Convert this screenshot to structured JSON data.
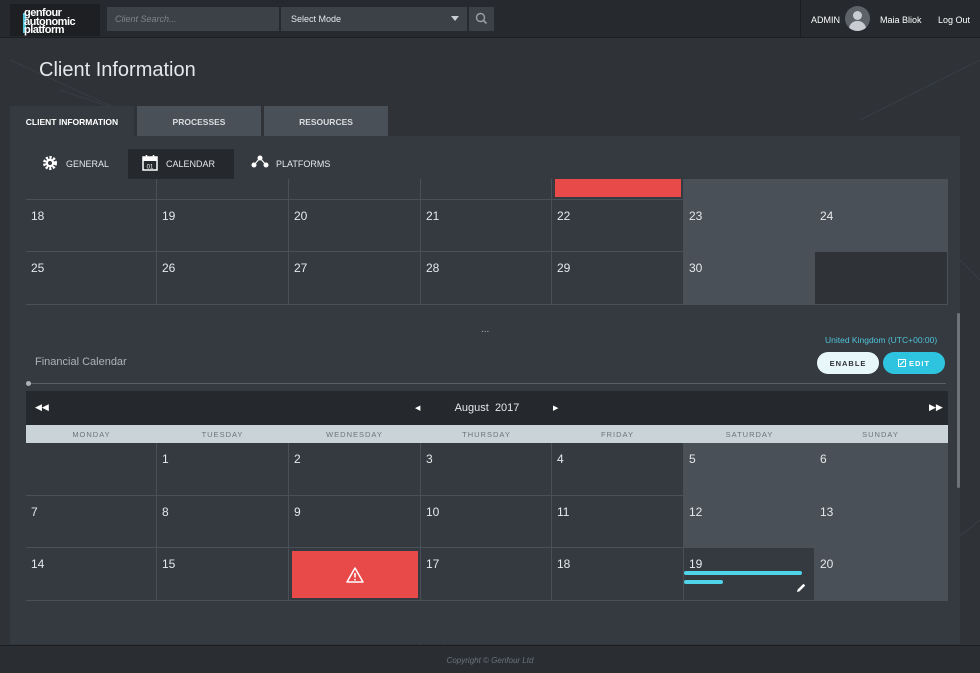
{
  "header": {
    "logo_lines": [
      "genfour",
      "autonomic",
      "platform"
    ],
    "search_placeholder": "Client Search...",
    "mode_select": "Select Mode",
    "role": "ADMIN",
    "user_name": "Maia Bliok",
    "logout": "Log Out"
  },
  "page_title": "Client Information",
  "main_tabs": [
    "CLIENT INFORMATION",
    "PROCESSES",
    "RESOURCES"
  ],
  "sub_tabs": [
    "GENERAL",
    "CALENDAR",
    "PLATFORMS"
  ],
  "upper_calendar": {
    "rows": [
      [
        "18",
        "19",
        "20",
        "21",
        "22",
        "23",
        "24"
      ],
      [
        "25",
        "26",
        "27",
        "28",
        "29",
        "30",
        ""
      ]
    ]
  },
  "ellipsis": "...",
  "financial_calendar": {
    "title": "Financial Calendar",
    "timezone": "United Kingdom (UTC+00:00)",
    "enable_label": "ENABLE",
    "edit_label": "EDIT",
    "month": "August",
    "year": "2017",
    "weekdays": [
      "MONDAY",
      "TUESDAY",
      "WEDNESDAY",
      "THURSDAY",
      "FRIDAY",
      "SATURDAY",
      "SUNDAY"
    ],
    "rows": [
      [
        "",
        "1",
        "2",
        "3",
        "4",
        "5",
        "6"
      ],
      [
        "7",
        "8",
        "9",
        "10",
        "11",
        "12",
        "13"
      ],
      [
        "14",
        "15",
        "",
        "17",
        "18",
        "19",
        "20"
      ]
    ],
    "alert_day_index": {
      "row": 2,
      "col": 2
    },
    "progress_day": "19",
    "progress_values": [
      1.0,
      0.33
    ]
  },
  "footer": "Copyright © Genfour Ltd",
  "colors": {
    "accent": "#2ec4e0",
    "alert": "#e84a4a",
    "background": "#2f3338"
  }
}
